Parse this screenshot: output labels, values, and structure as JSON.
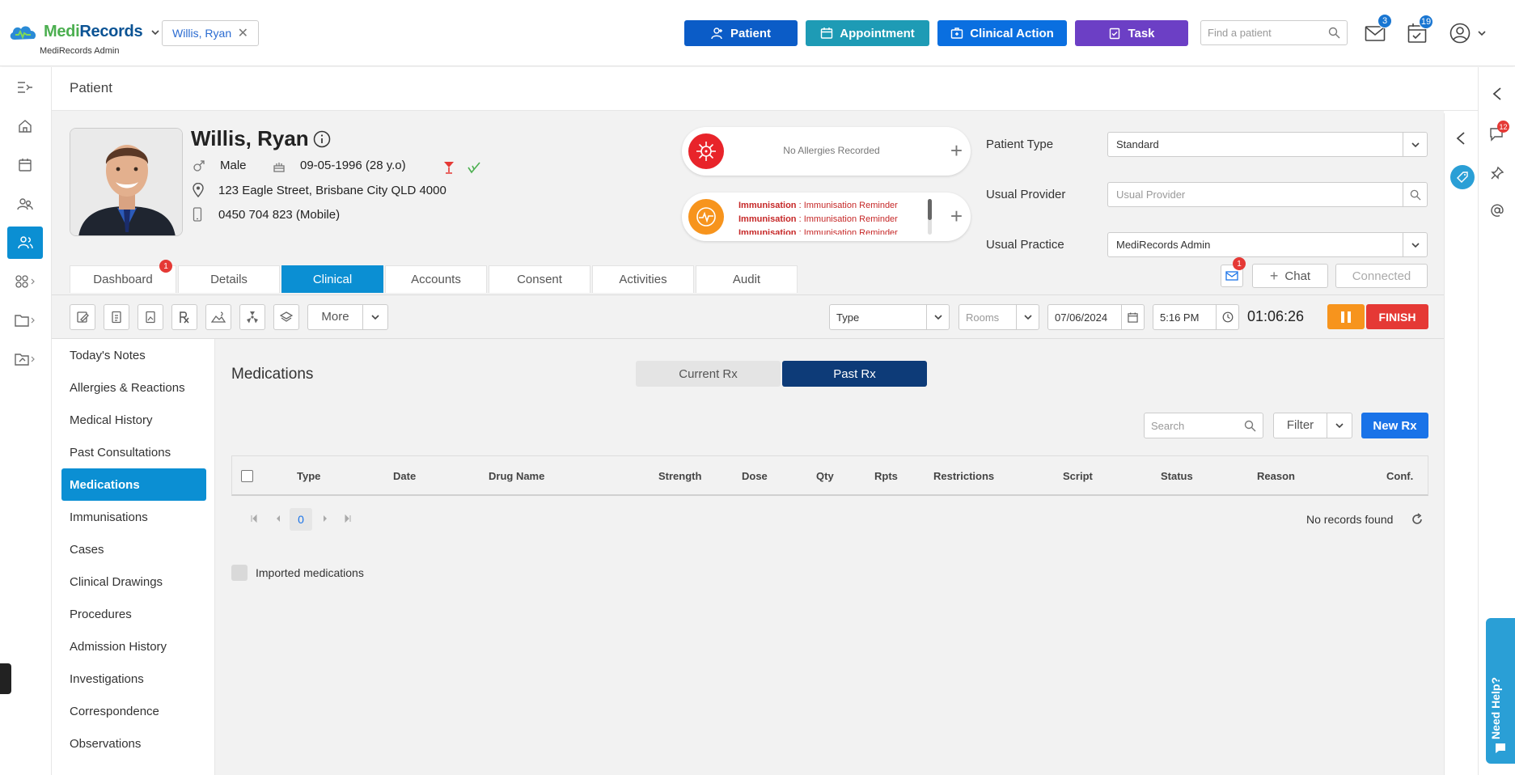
{
  "app": {
    "logo_medi": "Medi",
    "logo_records": "Records",
    "subtitle": "MediRecords Admin"
  },
  "header": {
    "patient_chip": "Willis, Ryan",
    "buttons": {
      "patient": "Patient",
      "appointment": "Appointment",
      "clinical_action": "Clinical Action",
      "task": "Task"
    },
    "find_placeholder": "Find a patient",
    "mail_count": "3",
    "tasks_count": "19"
  },
  "page": {
    "title": "Patient"
  },
  "patient": {
    "name": "Willis, Ryan",
    "gender": "Male",
    "dob": "09-05-1996 (28 y.o)",
    "address": "123 Eagle Street, Brisbane City QLD 4000",
    "phone": "0450 704 823 (Mobile)"
  },
  "alerts": {
    "allergies": "No Allergies Recorded",
    "immunisation_label": "Immunisation",
    "immunisation_sep": " : ",
    "immunisation_text": "Immunisation Reminder"
  },
  "fields": {
    "patient_type_label": "Patient Type",
    "patient_type_value": "Standard",
    "usual_provider_label": "Usual Provider",
    "usual_provider_placeholder": "Usual Provider",
    "usual_practice_label": "Usual Practice",
    "usual_practice_value": "MediRecords Admin"
  },
  "tabs": [
    {
      "label": "Dashboard",
      "badge": "1"
    },
    {
      "label": "Details"
    },
    {
      "label": "Clinical"
    },
    {
      "label": "Accounts"
    },
    {
      "label": "Consent"
    },
    {
      "label": "Activities"
    },
    {
      "label": "Audit"
    }
  ],
  "chat": {
    "mail_badge": "1",
    "chat_label": "Chat",
    "connected_label": "Connected"
  },
  "toolbar": {
    "more_label": "More",
    "type_label": "Type",
    "rooms_label": "Rooms",
    "date_value": "07/06/2024",
    "time_value": "5:16 PM",
    "timer": "01:06:26",
    "finish_label": "FINISH"
  },
  "sidemenu": [
    "Today's Notes",
    "Allergies & Reactions",
    "Medical History",
    "Past Consultations",
    "Medications",
    "Immunisations",
    "Cases",
    "Clinical Drawings",
    "Procedures",
    "Admission History",
    "Investigations",
    "Correspondence",
    "Observations"
  ],
  "main": {
    "title": "Medications",
    "seg_current": "Current Rx",
    "seg_past": "Past Rx",
    "search_placeholder": "Search",
    "filter_label": "Filter",
    "newrx_label": "New Rx",
    "columns": [
      "Type",
      "Date",
      "Drug Name",
      "Strength",
      "Dose",
      "Qty",
      "Rpts",
      "Restrictions",
      "Script",
      "Status",
      "Reason",
      "Conf."
    ],
    "page_number": "0",
    "no_records": "No records found",
    "imported_label": "Imported medications"
  },
  "right": {
    "notif_badge": "12",
    "need_help": "Need Help?"
  },
  "colors": {
    "patient_btn": "#0b5cc7",
    "appointment_btn": "#1e9bb5",
    "clinical_btn": "#0a6fe0",
    "task_btn": "#6c3fc5",
    "accent": "#0b8fd3",
    "past_rx": "#0d3b78"
  }
}
